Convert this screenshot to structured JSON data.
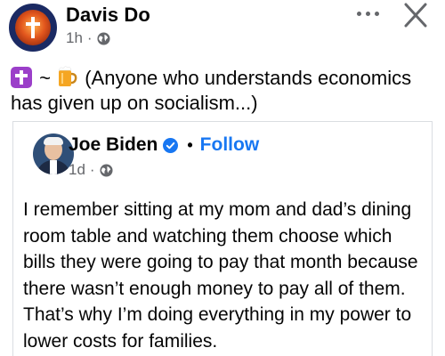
{
  "post": {
    "author": "Davis Do",
    "time": "1h",
    "meta_sep": "·",
    "text_prefix": "~",
    "text": "(Anyone who understands economics has given up on socialism...)",
    "emojis": [
      "latin-cross-emoji",
      "beer-mug-emoji"
    ]
  },
  "shared": {
    "author": "Joe Biden",
    "dot": "•",
    "follow": "Follow",
    "time": "1d",
    "meta_sep": "·",
    "body": "I remember sitting at my mom and dad’s dining room table and watching them choose which bills they were going to pay that month because there wasn’t enough money to pay all of them. That’s why I’m doing everything in my power to lower costs for families."
  },
  "icons": {
    "globe": "globe-icon",
    "more": "more-options-icon",
    "close": "close-icon",
    "verified": "verified-badge-icon"
  },
  "colors": {
    "link": "#1877f2",
    "meta": "#65676b",
    "text": "#050505",
    "border": "#dadde1"
  }
}
